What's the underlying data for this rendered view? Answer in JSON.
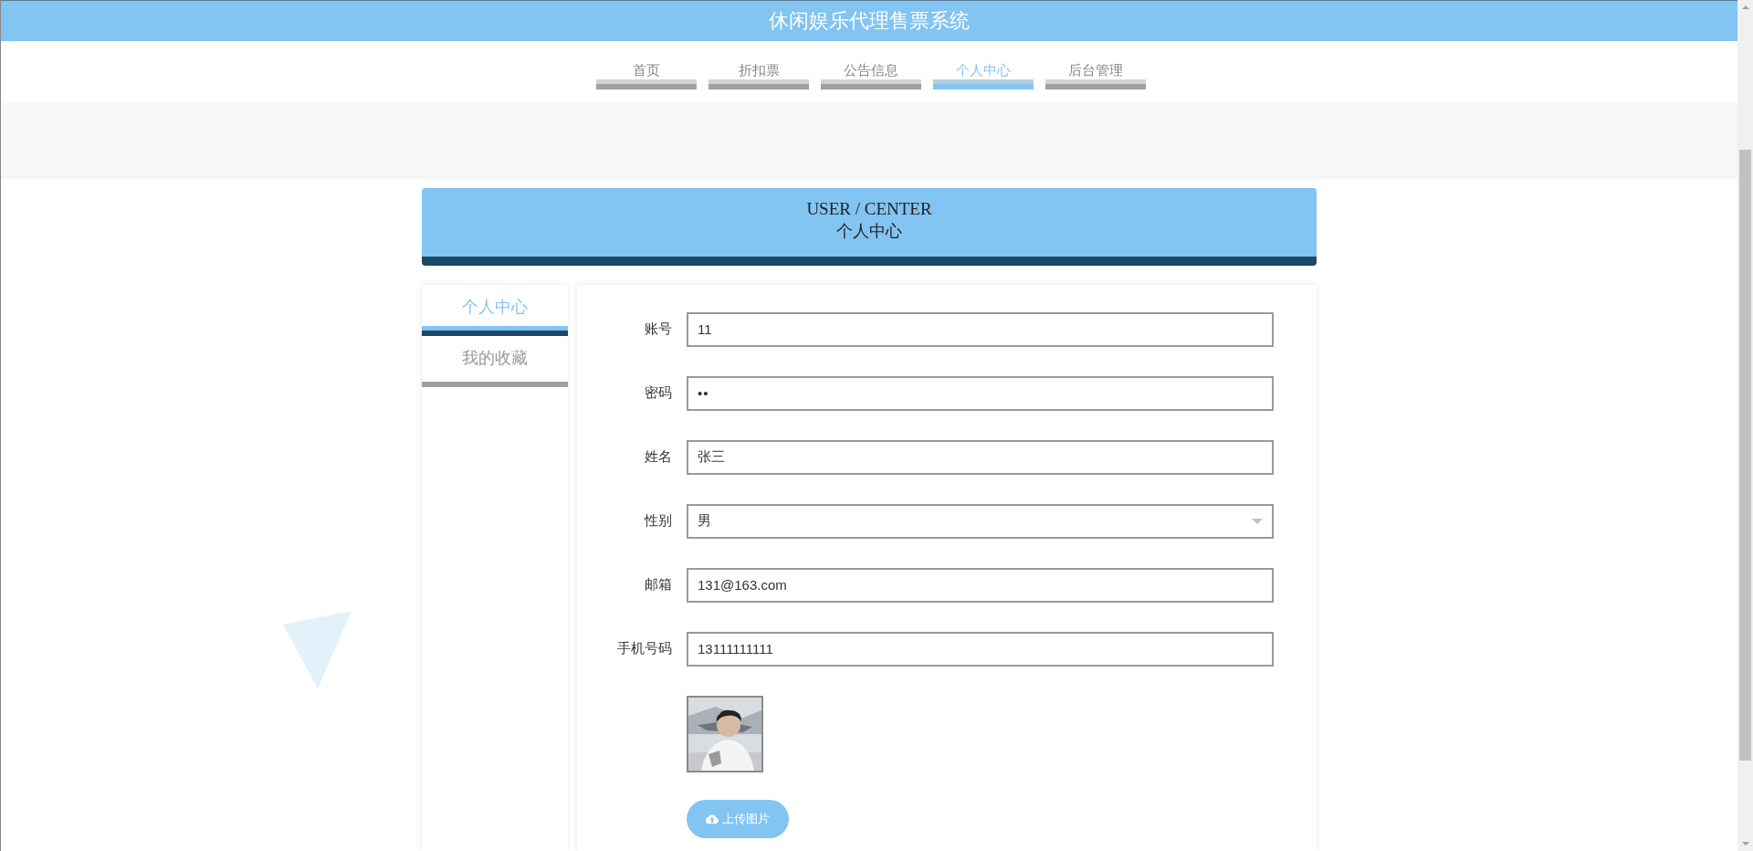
{
  "site_title": "休闲娱乐代理售票系统",
  "nav": [
    {
      "label": "首页",
      "selected": false
    },
    {
      "label": "折扣票",
      "selected": false
    },
    {
      "label": "公告信息",
      "selected": false
    },
    {
      "label": "个人中心",
      "selected": true
    },
    {
      "label": "后台管理",
      "selected": false
    }
  ],
  "banner": {
    "title_en": "USER / CENTER",
    "title_cn": "个人中心"
  },
  "sidebar": [
    {
      "label": "个人中心",
      "selected": true
    },
    {
      "label": "我的收藏",
      "selected": false
    }
  ],
  "form": {
    "fields": [
      {
        "label": "账号",
        "kind": "text",
        "value": "11"
      },
      {
        "label": "密码",
        "kind": "password",
        "value": "••"
      },
      {
        "label": "姓名",
        "kind": "text",
        "value": "张三"
      },
      {
        "label": "性别",
        "kind": "select",
        "value": "男"
      },
      {
        "label": "邮箱",
        "kind": "text",
        "value": "131@163.com"
      },
      {
        "label": "手机号码",
        "kind": "text",
        "value": "13111111111"
      }
    ],
    "upload_button": "上传图片"
  }
}
